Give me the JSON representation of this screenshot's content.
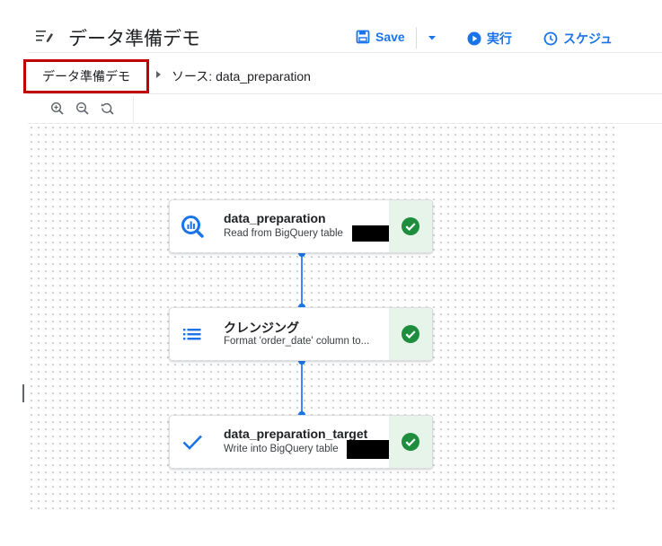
{
  "header": {
    "title": "データ準備デモ",
    "save_label": "Save",
    "run_label": "実行",
    "schedule_label": "スケジュ",
    "accent": "#1a73e8"
  },
  "breadcrumb": {
    "current": "データ準備デモ",
    "source": "ソース: data_preparation",
    "highlight_color": "#c00000"
  },
  "zoom": [
    "zoom-in-icon",
    "zoom-out-icon",
    "zoom-reset-icon"
  ],
  "pipeline": {
    "nodes": [
      {
        "name": "data_preparation",
        "description": "Read from BigQuery table",
        "icon": "bigquery-icon",
        "status": "success"
      },
      {
        "name": "クレンジング",
        "description": "Format 'order_date' column to...",
        "icon": "list-icon",
        "status": "success"
      },
      {
        "name": "data_preparation_target",
        "description": "Write into BigQuery table",
        "icon": "check-icon",
        "status": "success"
      }
    ],
    "status_color": "#1e8e3e"
  }
}
